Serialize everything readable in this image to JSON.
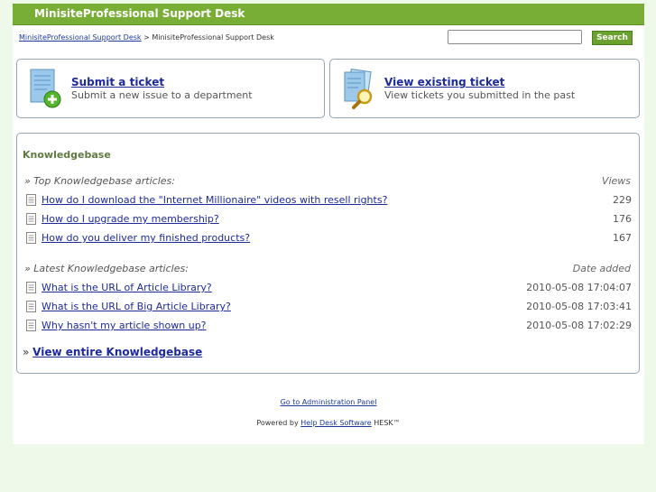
{
  "header": {
    "title": "MinisiteProfessional Support Desk"
  },
  "breadcrumb": {
    "home_link": "MinisiteProfessional Support Desk",
    "separator": ">",
    "current": "MinisiteProfessional Support Desk"
  },
  "search": {
    "placeholder": "",
    "value": "",
    "button_label": "Search"
  },
  "cards": {
    "submit": {
      "title": "Submit a ticket",
      "description": "Submit a new issue to a department",
      "icon": "submit-ticket-icon"
    },
    "view": {
      "title": "View existing ticket",
      "description": "View tickets you submitted in the past",
      "icon": "view-ticket-icon"
    }
  },
  "knowledgebase": {
    "title": "Knowledgebase",
    "top": {
      "heading": "» Top Knowledgebase articles:",
      "column": "Views",
      "items": [
        {
          "title": "How do I download the \"Internet Millionaire\" videos with resell rights?",
          "value": "229"
        },
        {
          "title": "How do I upgrade my membership?",
          "value": "176"
        },
        {
          "title": "How do you deliver my finished products?",
          "value": "167"
        }
      ]
    },
    "latest": {
      "heading": "» Latest Knowledgebase articles:",
      "column": "Date added",
      "items": [
        {
          "title": "What is the URL of Article Library?",
          "value": "2010-05-08 17:04:07"
        },
        {
          "title": "What is the URL of Big Article Library?",
          "value": "2010-05-08 17:03:41"
        },
        {
          "title": "Why hasn't my article shown up?",
          "value": "2010-05-08 17:02:29"
        }
      ]
    },
    "view_all": {
      "prefix": "»",
      "label": "View entire Knowledgebase"
    }
  },
  "footer": {
    "admin_link": "Go to Administration Panel",
    "powered_prefix": "Powered by",
    "powered_link": "Help Desk Software",
    "powered_suffix": "HESK™"
  },
  "colors": {
    "header": "#78ad36",
    "link": "#1d2a9c",
    "page_bg": "#eef9ea",
    "border": "#94a6b5"
  }
}
